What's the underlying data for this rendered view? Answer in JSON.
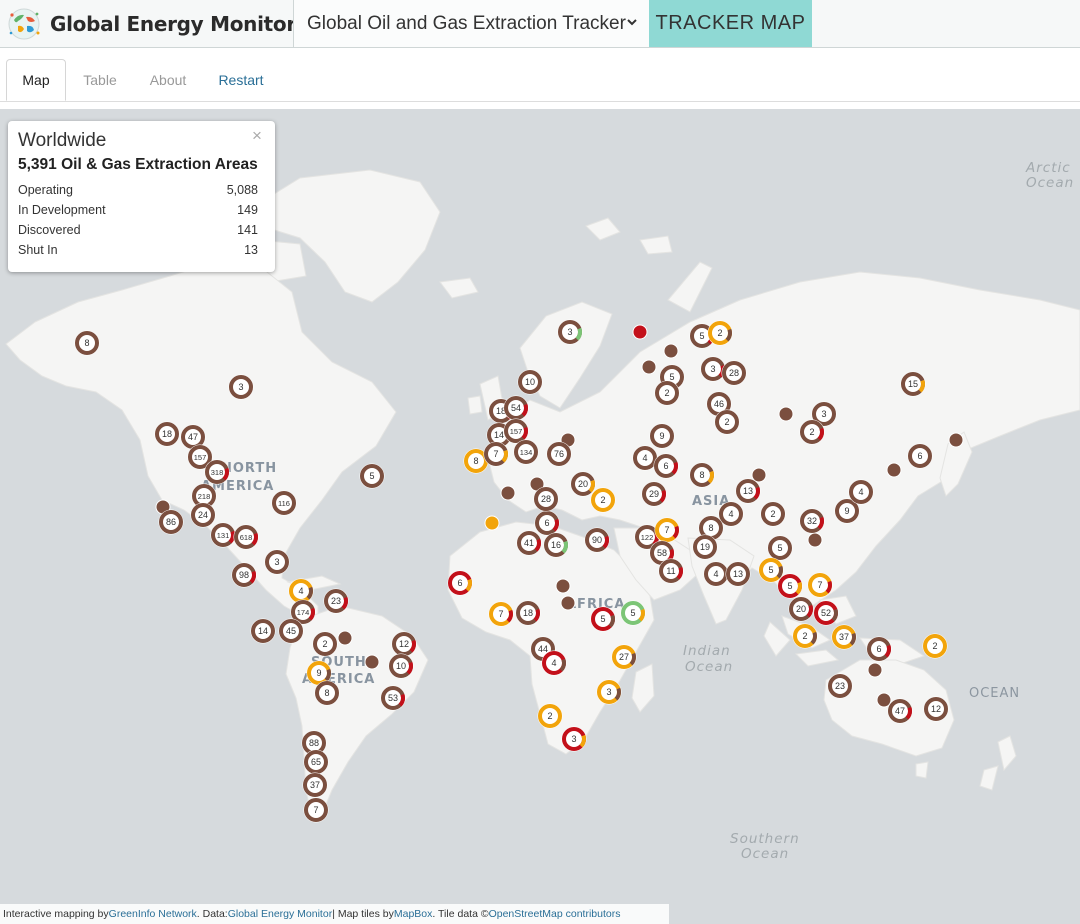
{
  "header": {
    "brand_title": "Global Energy Monitor",
    "tracker_select_value": "Global Oil and Gas Extraction Tracker",
    "tracker_map_label": "TRACKER MAP"
  },
  "tabs": [
    {
      "label": "Map",
      "active": true
    },
    {
      "label": "Table",
      "active": false
    },
    {
      "label": "About",
      "active": false
    },
    {
      "label": "Restart",
      "active": false
    }
  ],
  "infobox": {
    "title": "Worldwide",
    "close": "×",
    "subtitle": "5,391 Oil & Gas Extraction Areas",
    "rows": [
      {
        "label": "Operating",
        "value": "5,088"
      },
      {
        "label": "In Development",
        "value": "149"
      },
      {
        "label": "Discovered",
        "value": "141"
      },
      {
        "label": "Shut In",
        "value": "13"
      }
    ]
  },
  "map_labels": {
    "arctic_1": "Arctic",
    "arctic_2": "Ocean",
    "indian_1": "Indian",
    "indian_2": "Ocean",
    "southern_1": "Southern",
    "southern_2": "Ocean",
    "ocean": "OCEAN",
    "north_america_1": "NORTH",
    "north_america_2": "AMERICA",
    "south_america_1": "SOUTH",
    "south_america_2": "AMERICA",
    "africa": "AFRICA",
    "asia": "ASIA"
  },
  "colors": {
    "operating": "#7b4f3f",
    "in_development": "#c3101a",
    "discovered": "#f2a40b",
    "shut_in": "#7cc576"
  },
  "clusters": [
    {
      "label": "3",
      "c": "brown",
      "a": "green"
    },
    {
      "label": "5",
      "c": "brown",
      "a": "red"
    },
    {
      "label": "2",
      "c": "orange",
      "a": "brown"
    },
    {
      "label": "8",
      "c": "brown",
      "a": ""
    },
    {
      "label": "3",
      "c": "brown",
      "a": ""
    },
    {
      "label": "5",
      "c": "brown",
      "a": ""
    },
    {
      "label": "2",
      "c": "brown",
      "a": ""
    },
    {
      "label": "3",
      "c": "brown",
      "a": "red"
    },
    {
      "label": "28",
      "c": "brown",
      "a": ""
    },
    {
      "label": "15",
      "c": "brown",
      "a": "orange"
    },
    {
      "label": "10",
      "c": "brown",
      "a": ""
    },
    {
      "label": "18",
      "c": "brown",
      "a": "red"
    },
    {
      "label": "54",
      "c": "brown",
      "a": "red"
    },
    {
      "label": "14",
      "c": "brown",
      "a": ""
    },
    {
      "label": "157",
      "c": "brown",
      "a": "red"
    },
    {
      "label": "134",
      "c": "brown",
      "a": ""
    },
    {
      "label": "8",
      "c": "orange",
      "a": ""
    },
    {
      "label": "7",
      "c": "brown",
      "a": "orange"
    },
    {
      "label": "76",
      "c": "brown",
      "a": ""
    },
    {
      "label": "46",
      "c": "brown",
      "a": ""
    },
    {
      "label": "2",
      "c": "brown",
      "a": ""
    },
    {
      "label": "3",
      "c": "brown",
      "a": ""
    },
    {
      "label": "2",
      "c": "brown",
      "a": "red"
    },
    {
      "label": "18",
      "c": "brown",
      "a": ""
    },
    {
      "label": "47",
      "c": "brown",
      "a": ""
    },
    {
      "label": "157",
      "c": "brown",
      "a": ""
    },
    {
      "label": "318",
      "c": "brown",
      "a": "red"
    },
    {
      "label": "218",
      "c": "brown",
      "a": ""
    },
    {
      "label": "24",
      "c": "brown",
      "a": ""
    },
    {
      "label": "86",
      "c": "brown",
      "a": ""
    },
    {
      "label": "116",
      "c": "brown",
      "a": ""
    },
    {
      "label": "131",
      "c": "brown",
      "a": "red"
    },
    {
      "label": "618",
      "c": "brown",
      "a": "red"
    },
    {
      "label": "3",
      "c": "brown",
      "a": ""
    },
    {
      "label": "98",
      "c": "brown",
      "a": "red"
    },
    {
      "label": "5",
      "c": "brown",
      "a": ""
    },
    {
      "label": "9",
      "c": "brown",
      "a": ""
    },
    {
      "label": "4",
      "c": "brown",
      "a": ""
    },
    {
      "label": "6",
      "c": "brown",
      "a": ""
    },
    {
      "label": "8",
      "c": "brown",
      "a": "orange"
    },
    {
      "label": "6",
      "c": "brown",
      "a": "red"
    },
    {
      "label": "20",
      "c": "brown",
      "a": "orange"
    },
    {
      "label": "28",
      "c": "brown",
      "a": ""
    },
    {
      "label": "2",
      "c": "orange",
      "a": ""
    },
    {
      "label": "29",
      "c": "brown",
      "a": "red"
    },
    {
      "label": "13",
      "c": "brown",
      "a": "red"
    },
    {
      "label": "4",
      "c": "brown",
      "a": ""
    },
    {
      "label": "9",
      "c": "brown",
      "a": ""
    },
    {
      "label": "4",
      "c": "brown",
      "a": ""
    },
    {
      "label": "6",
      "c": "brown",
      "a": "red"
    },
    {
      "label": "41",
      "c": "brown",
      "a": "red"
    },
    {
      "label": "16",
      "c": "brown",
      "a": "green"
    },
    {
      "label": "90",
      "c": "brown",
      "a": "red"
    },
    {
      "label": "122",
      "c": "brown",
      "a": "red"
    },
    {
      "label": "7",
      "c": "orange",
      "a": "red"
    },
    {
      "label": "58",
      "c": "brown",
      "a": "red"
    },
    {
      "label": "11",
      "c": "brown",
      "a": "red"
    },
    {
      "label": "8",
      "c": "brown",
      "a": ""
    },
    {
      "label": "19",
      "c": "brown",
      "a": ""
    },
    {
      "label": "2",
      "c": "brown",
      "a": ""
    },
    {
      "label": "32",
      "c": "brown",
      "a": "red"
    },
    {
      "label": "5",
      "c": "brown",
      "a": ""
    },
    {
      "label": "4",
      "c": "brown",
      "a": ""
    },
    {
      "label": "13",
      "c": "brown",
      "a": ""
    },
    {
      "label": "5",
      "c": "orange",
      "a": "brown"
    },
    {
      "label": "5",
      "c": "red",
      "a": "orange"
    },
    {
      "label": "7",
      "c": "orange",
      "a": "red"
    },
    {
      "label": "20",
      "c": "brown",
      "a": "red"
    },
    {
      "label": "52",
      "c": "red",
      "a": "brown"
    },
    {
      "label": "2",
      "c": "orange",
      "a": "brown"
    },
    {
      "label": "37",
      "c": "orange",
      "a": "brown"
    },
    {
      "label": "6",
      "c": "brown",
      "a": "red"
    },
    {
      "label": "2",
      "c": "orange",
      "a": ""
    },
    {
      "label": "6",
      "c": "red",
      "a": "orange"
    },
    {
      "label": "7",
      "c": "orange",
      "a": "red"
    },
    {
      "label": "18",
      "c": "brown",
      "a": "red"
    },
    {
      "label": "5",
      "c": "red",
      "a": "brown"
    },
    {
      "label": "5",
      "c": "green",
      "a": "orange"
    },
    {
      "label": "44",
      "c": "brown",
      "a": ""
    },
    {
      "label": "4",
      "c": "red",
      "a": "brown"
    },
    {
      "label": "27",
      "c": "orange",
      "a": "brown"
    },
    {
      "label": "3",
      "c": "orange",
      "a": "brown"
    },
    {
      "label": "2",
      "c": "orange",
      "a": ""
    },
    {
      "label": "3",
      "c": "red",
      "a": "orange"
    },
    {
      "label": "4",
      "c": "orange",
      "a": "brown"
    },
    {
      "label": "23",
      "c": "brown",
      "a": "red"
    },
    {
      "label": "174",
      "c": "brown",
      "a": "red"
    },
    {
      "label": "14",
      "c": "brown",
      "a": ""
    },
    {
      "label": "45",
      "c": "brown",
      "a": ""
    },
    {
      "label": "2",
      "c": "brown",
      "a": ""
    },
    {
      "label": "9",
      "c": "orange",
      "a": "brown"
    },
    {
      "label": "8",
      "c": "brown",
      "a": ""
    },
    {
      "label": "12",
      "c": "brown",
      "a": "red"
    },
    {
      "label": "10",
      "c": "brown",
      "a": "red"
    },
    {
      "label": "53",
      "c": "brown",
      "a": "red"
    },
    {
      "label": "88",
      "c": "brown",
      "a": ""
    },
    {
      "label": "65",
      "c": "brown",
      "a": ""
    },
    {
      "label": "37",
      "c": "brown",
      "a": ""
    },
    {
      "label": "7",
      "c": "brown",
      "a": ""
    },
    {
      "label": "23",
      "c": "brown",
      "a": ""
    },
    {
      "label": "47",
      "c": "brown",
      "a": "red"
    },
    {
      "label": "12",
      "c": "brown",
      "a": ""
    }
  ],
  "dots": [
    {
      "c": "red"
    },
    {
      "c": "brown"
    },
    {
      "c": "brown"
    },
    {
      "c": "brown"
    },
    {
      "c": "brown"
    },
    {
      "c": "brown"
    },
    {
      "c": "brown"
    },
    {
      "c": "brown"
    },
    {
      "c": "brown"
    },
    {
      "c": "orange"
    },
    {
      "c": "brown"
    },
    {
      "c": "brown"
    },
    {
      "c": "brown"
    },
    {
      "c": "brown"
    },
    {
      "c": "brown"
    },
    {
      "c": "brown"
    },
    {
      "c": "brown"
    },
    {
      "c": "brown"
    },
    {
      "c": "brown"
    }
  ],
  "attribution": {
    "t1": "Interactive mapping by ",
    "l1": "GreenInfo Network",
    "t2": ". Data: ",
    "l2": "Global Energy Monitor",
    "t3": " | Map tiles by ",
    "l3": "MapBox",
    "t4": ". Tile data © ",
    "l4": "OpenStreetMap contributors"
  }
}
